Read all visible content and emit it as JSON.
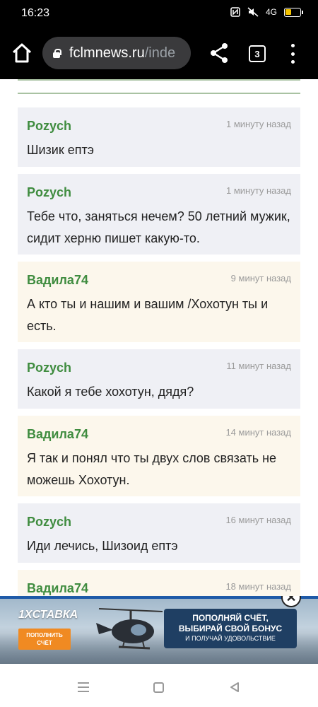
{
  "status_bar": {
    "time": "16:23",
    "icons": [
      "nfc-icon",
      "mute-icon",
      "signal-4g-icon",
      "battery-icon"
    ],
    "network": "4G"
  },
  "browser": {
    "url_host": "fclmnews.ru",
    "url_path": "/inde",
    "tab_count": "3"
  },
  "comments": [
    {
      "author": "Pozych",
      "time": "1 минуту назад",
      "text": "Шизик ептэ",
      "style": "blue"
    },
    {
      "author": "Pozych",
      "time": "1 минуту назад",
      "text": "Тебе что, заняться нечем? 50 летний мужик, сидит херню пишет какую-то.",
      "style": "blue"
    },
    {
      "author": "Вадила74",
      "time": "9 минут назад",
      "text": "А кто ты и нашим и вашим /Хохотун ты и есть.",
      "style": "cream"
    },
    {
      "author": "Pozych",
      "time": "11 минут назад",
      "text": "Какой я тебе хохотун, дядя?",
      "style": "blue"
    },
    {
      "author": "Вадила74",
      "time": "14 минут назад",
      "text": "Я так и понял что ты двух слов связать не можешь Хохотун.",
      "style": "cream"
    },
    {
      "author": "Pozych",
      "time": "16 минут назад",
      "text": "Иди лечись, Шизоид ептэ",
      "style": "blue"
    },
    {
      "author": "Вадила74",
      "time": "18 минут назад",
      "text": "",
      "style": "cream"
    }
  ],
  "ad": {
    "logo": "1XСТАВКА",
    "cta": "ПОПОЛНИТЬ СЧЁТ",
    "line1": "ПОПОЛНЯЙ СЧЁТ,",
    "line2": "ВЫБИРАЙ СВОЙ БОНУС",
    "line3": "И ПОЛУЧАЙ УДОВОЛЬСТВИЕ",
    "close_symbol": "✕"
  },
  "colors": {
    "author": "#3f8c3f",
    "comment_bg_blue": "#eff0f5",
    "comment_bg_cream": "#fcf7ec",
    "rule": "#a9c2a2"
  }
}
